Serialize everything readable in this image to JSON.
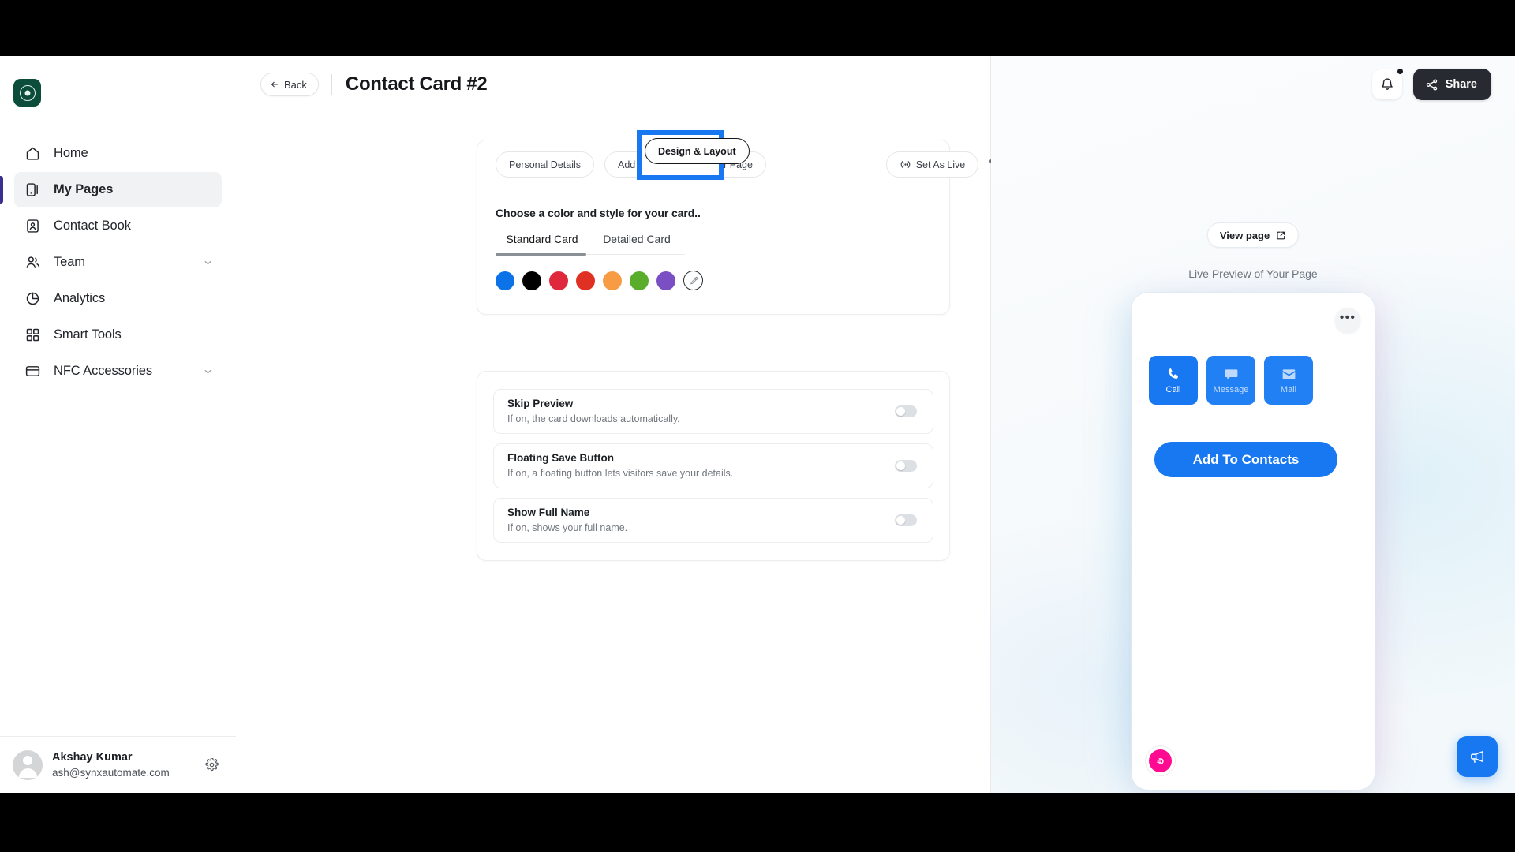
{
  "app": {
    "logo_icon": "app-logo-icon"
  },
  "sidebar": {
    "items": [
      {
        "label": "Home",
        "icon": "home-icon",
        "active": false,
        "chevron": false
      },
      {
        "label": "My Pages",
        "icon": "pages-icon",
        "active": true,
        "chevron": false
      },
      {
        "label": "Contact Book",
        "icon": "contact-book-icon",
        "active": false,
        "chevron": false
      },
      {
        "label": "Team",
        "icon": "team-icon",
        "active": false,
        "chevron": true
      },
      {
        "label": "Analytics",
        "icon": "analytics-icon",
        "active": false,
        "chevron": false
      },
      {
        "label": "Smart Tools",
        "icon": "grid-icon",
        "active": false,
        "chevron": false
      },
      {
        "label": "NFC Accessories",
        "icon": "card-icon",
        "active": false,
        "chevron": true
      }
    ],
    "user": {
      "name": "Akshay Kumar",
      "email": "ash@synxautomate.com",
      "avatar_icon": "avatar-icon",
      "settings_icon": "gear-icon"
    }
  },
  "topbar": {
    "back_label": "Back",
    "back_icon": "arrow-left-icon",
    "title": "Contact Card #2"
  },
  "header_actions": {
    "bell_icon": "bell-icon",
    "has_notification": true,
    "share_label": "Share",
    "share_icon": "share-icon"
  },
  "design_panel": {
    "tabs": [
      {
        "label": "Personal Details",
        "selected": false
      },
      {
        "label": "Add More Details to Your Page",
        "selected": false
      },
      {
        "label": "Design & Layout",
        "selected": true
      }
    ],
    "set_as_live_label": "Set As Live",
    "set_as_live_icon": "broadcast-icon",
    "overflow_icon": "ellipsis-icon",
    "heading": "Choose a color and style for your card..",
    "card_tabs": [
      {
        "label": "Standard Card",
        "active": true
      },
      {
        "label": "Detailed Card",
        "active": false
      }
    ],
    "swatches": [
      {
        "name": "blue",
        "hex": "#0B72E8"
      },
      {
        "name": "black",
        "hex": "#000000"
      },
      {
        "name": "crimson",
        "hex": "#E0283C"
      },
      {
        "name": "red",
        "hex": "#E03024"
      },
      {
        "name": "orange",
        "hex": "#F79B45"
      },
      {
        "name": "green",
        "hex": "#5AAD2B"
      },
      {
        "name": "purple",
        "hex": "#7A4FC4"
      }
    ],
    "custom_swatch_icon": "eyedropper-icon",
    "highlight_color": "#1878F2"
  },
  "settings": {
    "rows": [
      {
        "title": "Skip Preview",
        "subtitle": "If on, the card downloads automatically.",
        "enabled": false
      },
      {
        "title": "Floating Save Button",
        "subtitle": "If on, a floating button lets visitors save your details.",
        "enabled": false
      },
      {
        "title": "Show Full Name",
        "subtitle": "If on, shows your full name.",
        "enabled": false
      }
    ]
  },
  "preview": {
    "view_page_label": "View page",
    "view_page_icon": "external-link-icon",
    "caption": "Live Preview of Your Page",
    "card_menu_icon": "ellipsis-icon",
    "actions": [
      {
        "label": "Call",
        "icon": "phone-icon"
      },
      {
        "label": "Message",
        "icon": "message-icon"
      },
      {
        "label": "Mail",
        "icon": "envelope-icon"
      }
    ],
    "add_to_contacts_label": "Add To Contacts",
    "badge_icon": "brand-badge-icon",
    "badge_color": "#FF0A91",
    "accent_color": "#1878F2"
  },
  "chat_fab": {
    "icon": "megaphone-icon"
  }
}
